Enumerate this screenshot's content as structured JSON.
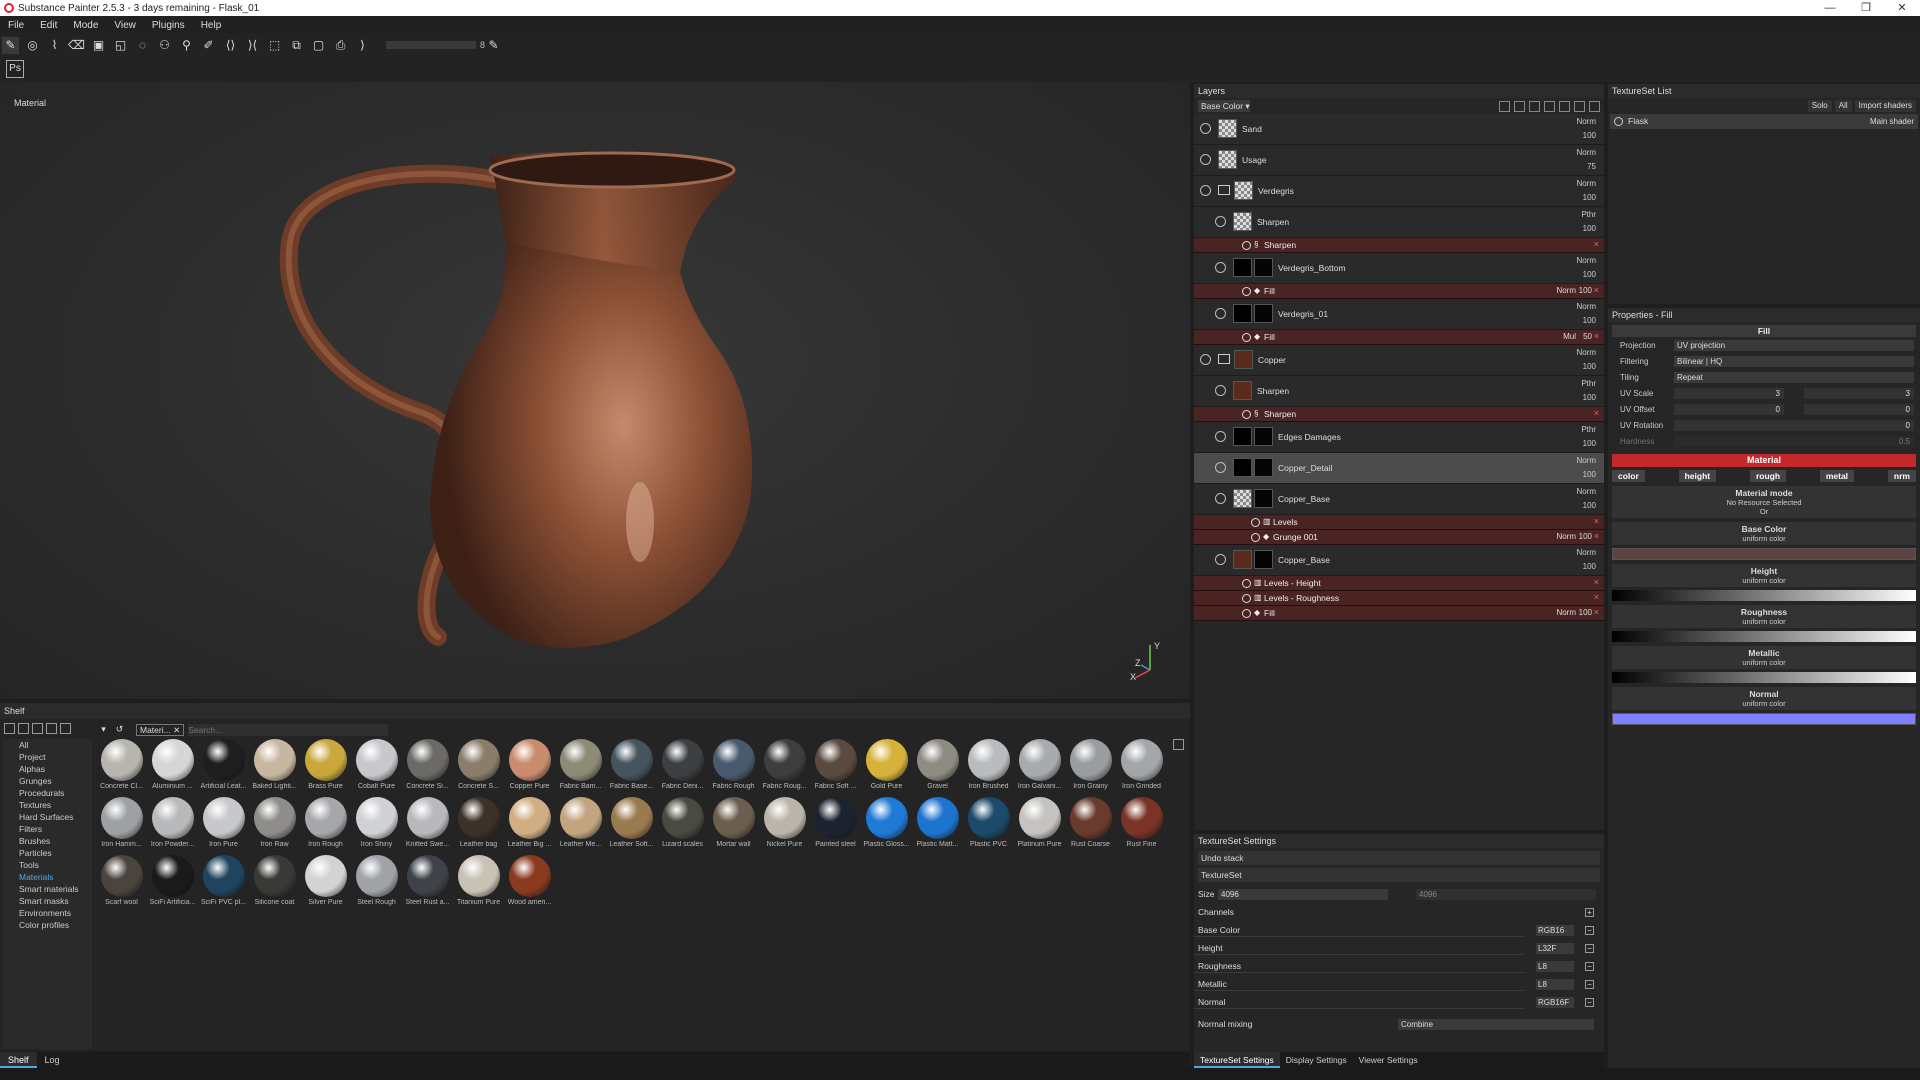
{
  "window": {
    "title": "Substance Painter 2.5.3 - 3 days remaining - Flask_01",
    "controls": [
      "—",
      "❐",
      "✕"
    ]
  },
  "menu": [
    "File",
    "Edit",
    "Mode",
    "View",
    "Plugins",
    "Help"
  ],
  "toolbar": {
    "tools": [
      "paint-tool-icon",
      "smudge-tool-icon",
      "brush-tool-icon",
      "eraser-tool-icon",
      "projection-tool-icon",
      "polygon-fill-icon",
      "geometry-mask-icon",
      "clone-tool-icon",
      "material-picker-icon",
      "color-picker-icon",
      "symmetry-icon",
      "symmetry-mirror-icon",
      "camera-icon",
      "render-icon",
      "display-icon",
      "screenshot-icon"
    ],
    "slider_value": "8",
    "ps_label": "Ps"
  },
  "viewport": {
    "label": "Material",
    "axis": {
      "y": "Y",
      "z": "Z",
      "x": "X"
    }
  },
  "shelf": {
    "title": "Shelf",
    "categories": [
      "All",
      "Project",
      "Alphas",
      "Grunges",
      "Procedurals",
      "Textures",
      "Hard Surfaces",
      "Filters",
      "Brushes",
      "Particles",
      "Tools",
      "Materials",
      "Smart materials",
      "Smart masks",
      "Environments",
      "Color profiles"
    ],
    "active_category": "Materials",
    "filter_tag": "Materi...",
    "search_placeholder": "Search...",
    "materials": [
      {
        "name": "Concrete Cl...",
        "color": "#b8b5ae"
      },
      {
        "name": "Aluminium ...",
        "color": "#d6d6d6"
      },
      {
        "name": "Artificial Leat...",
        "color": "#1f1f1f"
      },
      {
        "name": "Baked Lighti...",
        "color": "#c8b7a0"
      },
      {
        "name": "Brass Pure",
        "color": "#c9a73b"
      },
      {
        "name": "Cobalt Pure",
        "color": "#c6c8cc"
      },
      {
        "name": "Concrete Si...",
        "color": "#6c6a66"
      },
      {
        "name": "Concrete S...",
        "color": "#8b7d6a"
      },
      {
        "name": "Copper Pure",
        "color": "#c98c6e"
      },
      {
        "name": "Fabric Bam...",
        "color": "#8d8a76"
      },
      {
        "name": "Fabric Base...",
        "color": "#46545e"
      },
      {
        "name": "Fabric Deni...",
        "color": "#3c4043"
      },
      {
        "name": "Fabric Rough",
        "color": "#4a5a6e"
      },
      {
        "name": "Fabric Roug...",
        "color": "#3e3e3e"
      },
      {
        "name": "Fabric Soft ...",
        "color": "#5a4a40"
      },
      {
        "name": "Gold Pure",
        "color": "#d6b23a"
      },
      {
        "name": "Gravel",
        "color": "#8e8b83"
      },
      {
        "name": "Iron Brushed",
        "color": "#b9bcbf"
      },
      {
        "name": "Iron Galvani...",
        "color": "#a8abae"
      },
      {
        "name": "Iron Grainy",
        "color": "#9a9d9f"
      },
      {
        "name": "Iron Grinded",
        "color": "#a3a6a9"
      },
      {
        "name": "Iron Hamm...",
        "color": "#9ea1a4"
      },
      {
        "name": "Iron Powder...",
        "color": "#b7b9bb"
      },
      {
        "name": "Iron Pure",
        "color": "#c6c8cb"
      },
      {
        "name": "Iron Raw",
        "color": "#8f8d89"
      },
      {
        "name": "Iron Rough",
        "color": "#a5a7aa"
      },
      {
        "name": "Iron Shiny",
        "color": "#cfd1d4"
      },
      {
        "name": "Knitted Swe...",
        "color": "#b9b8bd"
      },
      {
        "name": "Leather bag",
        "color": "#3e3129"
      },
      {
        "name": "Leather Big ...",
        "color": "#d0ad82"
      },
      {
        "name": "Leather Me...",
        "color": "#c2a57f"
      },
      {
        "name": "Leather Soft...",
        "color": "#9a7a4f"
      },
      {
        "name": "Lizard scales",
        "color": "#4b4a40"
      },
      {
        "name": "Mortar wall",
        "color": "#6c5e4e"
      },
      {
        "name": "Nickel Pure",
        "color": "#bab5a8"
      },
      {
        "name": "Painted steel",
        "color": "#1c2330"
      },
      {
        "name": "Plastic Gloss...",
        "color": "#1f7ad6"
      },
      {
        "name": "Plastic Matt...",
        "color": "#1d74cf"
      },
      {
        "name": "Plastic PVC",
        "color": "#1b4a6a"
      },
      {
        "name": "Platinum Pure",
        "color": "#c5c3c0"
      },
      {
        "name": "Rust Coarse",
        "color": "#6a3a2c"
      },
      {
        "name": "Rust Fine",
        "color": "#7a3324"
      },
      {
        "name": "Scarf wool",
        "color": "#4a443d"
      },
      {
        "name": "SciFi Artificia...",
        "color": "#1a1a1c"
      },
      {
        "name": "SciFi PVC pl...",
        "color": "#1e4460"
      },
      {
        "name": "Silicone coat",
        "color": "#3a3936"
      },
      {
        "name": "Silver Pure",
        "color": "#d2d3d4"
      },
      {
        "name": "Steel Rough",
        "color": "#9fa3a8"
      },
      {
        "name": "Steel Rust a...",
        "color": "#3e434a"
      },
      {
        "name": "Titanium Pure",
        "color": "#c9c1b4"
      },
      {
        "name": "Wood ameri...",
        "color": "#8a3a1f"
      }
    ]
  },
  "bottom_tabs": [
    "Shelf",
    "Log"
  ],
  "layers": {
    "title": "Layers",
    "channel_dropdown": "Base Color",
    "rows": [
      {
        "kind": "layer",
        "name": "Sand",
        "blend": "Norm",
        "opacity": "100",
        "indent": 0,
        "thumb": "checker"
      },
      {
        "kind": "layer",
        "name": "Usage",
        "blend": "Norm",
        "opacity": "75",
        "indent": 0,
        "thumb": "checker"
      },
      {
        "kind": "group",
        "name": "Verdegris",
        "blend": "Norm",
        "opacity": "100",
        "indent": 0,
        "thumb": "checker"
      },
      {
        "kind": "layer",
        "name": "Sharpen",
        "blend": "Pthr",
        "opacity": "100",
        "indent": 1,
        "thumb": "checker"
      },
      {
        "kind": "effect",
        "name": "Sharpen",
        "blend": "",
        "opacity": "",
        "indent": 2,
        "icon": "sharpen-icon"
      },
      {
        "kind": "layer",
        "name": "Verdegris_Bottom",
        "blend": "Norm",
        "opacity": "100",
        "indent": 1,
        "thumb": "black",
        "mask": true
      },
      {
        "kind": "effect",
        "name": "Fill",
        "blend": "Norm",
        "opacity": "100",
        "indent": 2,
        "icon": "fill-icon"
      },
      {
        "kind": "layer",
        "name": "Verdegris_01",
        "blend": "Norm",
        "opacity": "100",
        "indent": 1,
        "thumb": "black",
        "mask": true
      },
      {
        "kind": "effect",
        "name": "Fill",
        "blend": "Mul",
        "opacity": "50",
        "indent": 2,
        "icon": "fill-icon"
      },
      {
        "kind": "group",
        "name": "Copper",
        "blend": "Norm",
        "opacity": "100",
        "indent": 0,
        "thumb": "copper"
      },
      {
        "kind": "layer",
        "name": "Sharpen",
        "blend": "Pthr",
        "opacity": "100",
        "indent": 1,
        "thumb": "copper"
      },
      {
        "kind": "effect",
        "name": "Sharpen",
        "blend": "",
        "opacity": "",
        "indent": 2,
        "icon": "sharpen-icon"
      },
      {
        "kind": "layer",
        "name": "Edges Damages",
        "blend": "Pthr",
        "opacity": "100",
        "indent": 1,
        "thumb": "black",
        "mask": true
      },
      {
        "kind": "layer",
        "name": "Copper_Detail",
        "blend": "Norm",
        "opacity": "100",
        "indent": 1,
        "thumb": "black",
        "mask": true,
        "selected": true
      },
      {
        "kind": "layer",
        "name": "Copper_Base",
        "blend": "Norm",
        "opacity": "100",
        "indent": 1,
        "thumb": "checker",
        "mask": true
      },
      {
        "kind": "effect",
        "name": "Levels",
        "blend": "",
        "opacity": "",
        "indent": 3,
        "icon": "levels-icon"
      },
      {
        "kind": "effect",
        "name": "Grunge 001",
        "blend": "Norm",
        "opacity": "100",
        "indent": 3,
        "icon": "fill-icon"
      },
      {
        "kind": "layer",
        "name": "Copper_Base",
        "blend": "Norm",
        "opacity": "100",
        "indent": 1,
        "thumb": "copper",
        "mask": true
      },
      {
        "kind": "effect",
        "name": "Levels - Height",
        "blend": "",
        "opacity": "",
        "indent": 2,
        "icon": "levels-icon"
      },
      {
        "kind": "effect",
        "name": "Levels - Roughness",
        "blend": "",
        "opacity": "",
        "indent": 2,
        "icon": "levels-icon"
      },
      {
        "kind": "effect",
        "name": "Fill",
        "blend": "Norm",
        "opacity": "100",
        "indent": 2,
        "icon": "fill-icon"
      }
    ]
  },
  "textureset_settings": {
    "title": "TextureSet Settings",
    "undo_stack": "Undo stack",
    "textureset_label": "TextureSet",
    "size_label": "Size",
    "size_value": "4096",
    "size_value2": "4096",
    "channels_label": "Channels",
    "channels": [
      {
        "name": "Base Color",
        "format": "RGB16"
      },
      {
        "name": "Height",
        "format": "L32F"
      },
      {
        "name": "Roughness",
        "format": "L8"
      },
      {
        "name": "Metallic",
        "format": "L8"
      },
      {
        "name": "Normal",
        "format": "RGB16F"
      }
    ],
    "normal_mixing_label": "Normal mixing",
    "normal_mixing_value": "Combine",
    "tabs": [
      "TextureSet Settings",
      "Display Settings",
      "Viewer Settings"
    ]
  },
  "textureset_list": {
    "title": "TextureSet List",
    "buttons": [
      "Solo",
      "All",
      "Import shaders"
    ],
    "sets": [
      {
        "name": "Flask",
        "shader": "Main shader"
      }
    ]
  },
  "properties": {
    "title": "Properties - Fill",
    "fill_section": "Fill",
    "projection_label": "Projection",
    "projection_value": "UV projection",
    "filtering_label": "Filtering",
    "filtering_value": "Bilinear | HQ",
    "tiling_label": "Tiling",
    "tiling_value": "Repeat",
    "uv_scale_label": "UV Scale",
    "uv_scale_value": "3",
    "uv_scale_value2": "3",
    "uv_offset_label": "UV Offset",
    "uv_offset_value": "0",
    "uv_offset_value2": "0",
    "uv_rotation_label": "UV Rotation",
    "uv_rotation_value": "0",
    "hardness_label": "Hardness",
    "hardness_value": "0.5",
    "material_section": "Material",
    "channels": [
      "color",
      "height",
      "rough",
      "metal",
      "nrm"
    ],
    "material_mode": "Material mode",
    "no_resource": "No Resource Selected",
    "or": "Or",
    "blocks": [
      {
        "title": "Base Color",
        "sub": "uniform color",
        "kind": "swatch",
        "color": "#5a4340"
      },
      {
        "title": "Height",
        "sub": "uniform color",
        "kind": "gradient"
      },
      {
        "title": "Roughness",
        "sub": "uniform color",
        "kind": "gradient"
      },
      {
        "title": "Metallic",
        "sub": "uniform color",
        "kind": "gradient"
      },
      {
        "title": "Normal",
        "sub": "uniform color",
        "kind": "swatch",
        "color": "#7f7fff"
      }
    ],
    "accent_color": "#c3282d"
  }
}
